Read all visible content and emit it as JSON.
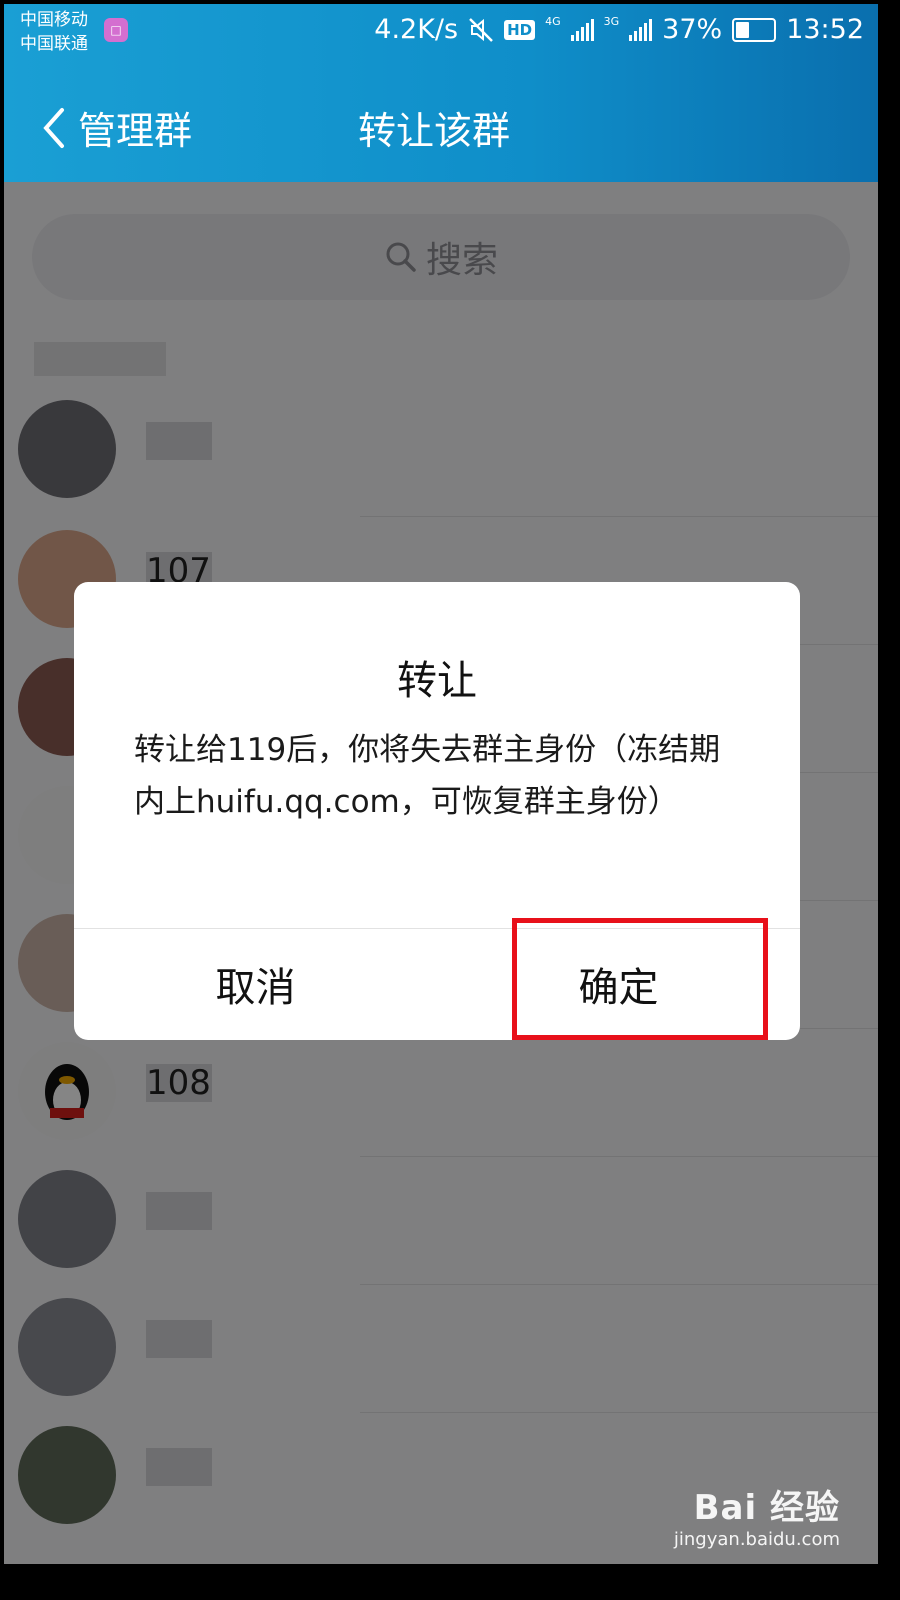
{
  "status_bar": {
    "carrier_1": "中国移动",
    "carrier_2": "中国联通",
    "app_badge": "□",
    "speed": "4.2K/s",
    "hd": "HD",
    "net_1": "4G",
    "net_2": "3G",
    "battery": "37%",
    "battery_level": 0.37,
    "time": "13:52"
  },
  "header": {
    "back_label": "管理群",
    "title": "转让该群",
    "color": "#1a9fd4"
  },
  "search": {
    "placeholder": "搜索"
  },
  "members": [
    {
      "name": ""
    },
    {
      "name": "107"
    },
    {
      "name": ""
    },
    {
      "name": ""
    },
    {
      "name": ""
    },
    {
      "name": "108"
    },
    {
      "name": ""
    },
    {
      "name": ""
    },
    {
      "name": ""
    }
  ],
  "dialog": {
    "title": "转让",
    "message": "转让给119后，你将失去群主身份（冻结期内上huifu.qq.com，可恢复群主身份）",
    "cancel": "取消",
    "confirm": "确定",
    "highlight_color": "#e8101a"
  },
  "watermark": {
    "logo": "Bai 经验",
    "url": "jingyan.baidu.com"
  }
}
